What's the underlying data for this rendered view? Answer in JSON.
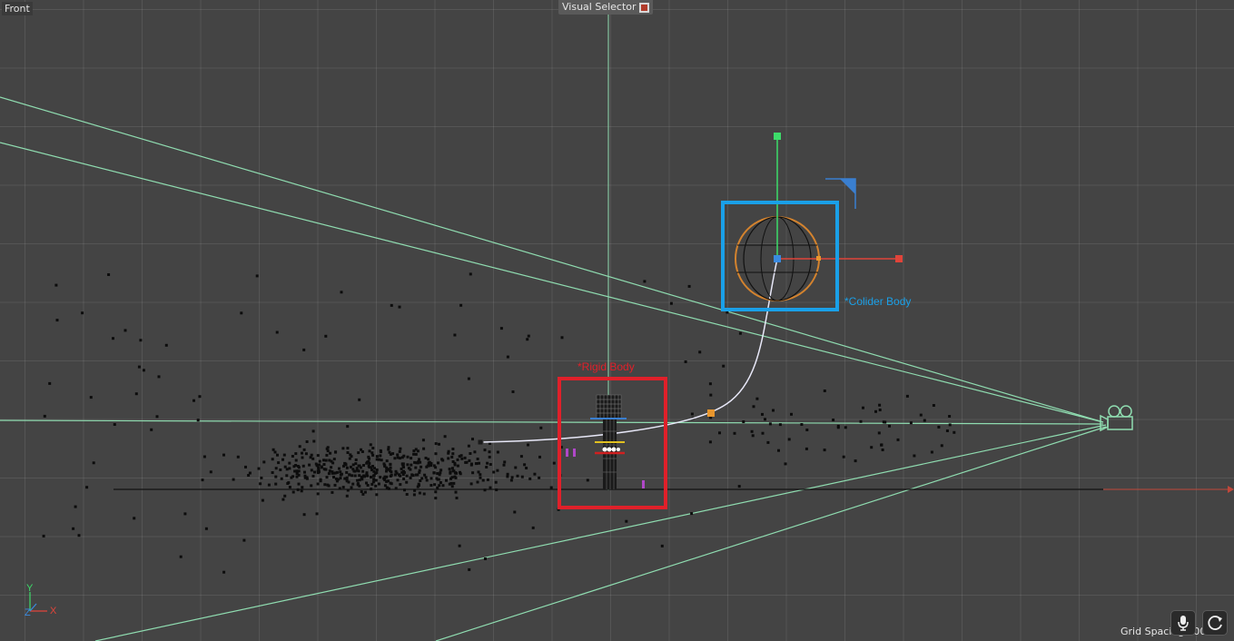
{
  "viewport": {
    "view_name": "Front",
    "visual_selector_label": "Visual Selector",
    "grid_spacing_label": "Grid Spacing",
    "grid_spacing_value": "100",
    "axis_labels": {
      "y": "Y",
      "x": "X",
      "z": "Z"
    }
  },
  "annotations": {
    "collider_label": "*Colider Body",
    "rigid_label": "*Rigid Body"
  },
  "colors": {
    "background": "#444444",
    "frustum_lines": "#8fdcb0",
    "x_axis": "#e0443a",
    "y_axis": "#3ddc6a",
    "collider_box": "#1aa0e8",
    "rigid_box": "#e0202a",
    "sphere": "#d4832e",
    "path": "#e8e8f8",
    "path_handle": "#e8962e"
  },
  "icons": {
    "camera": "camera-icon",
    "microphone": "microphone-icon",
    "refresh": "refresh-icon",
    "visual_selector": "visual-selector-icon"
  }
}
